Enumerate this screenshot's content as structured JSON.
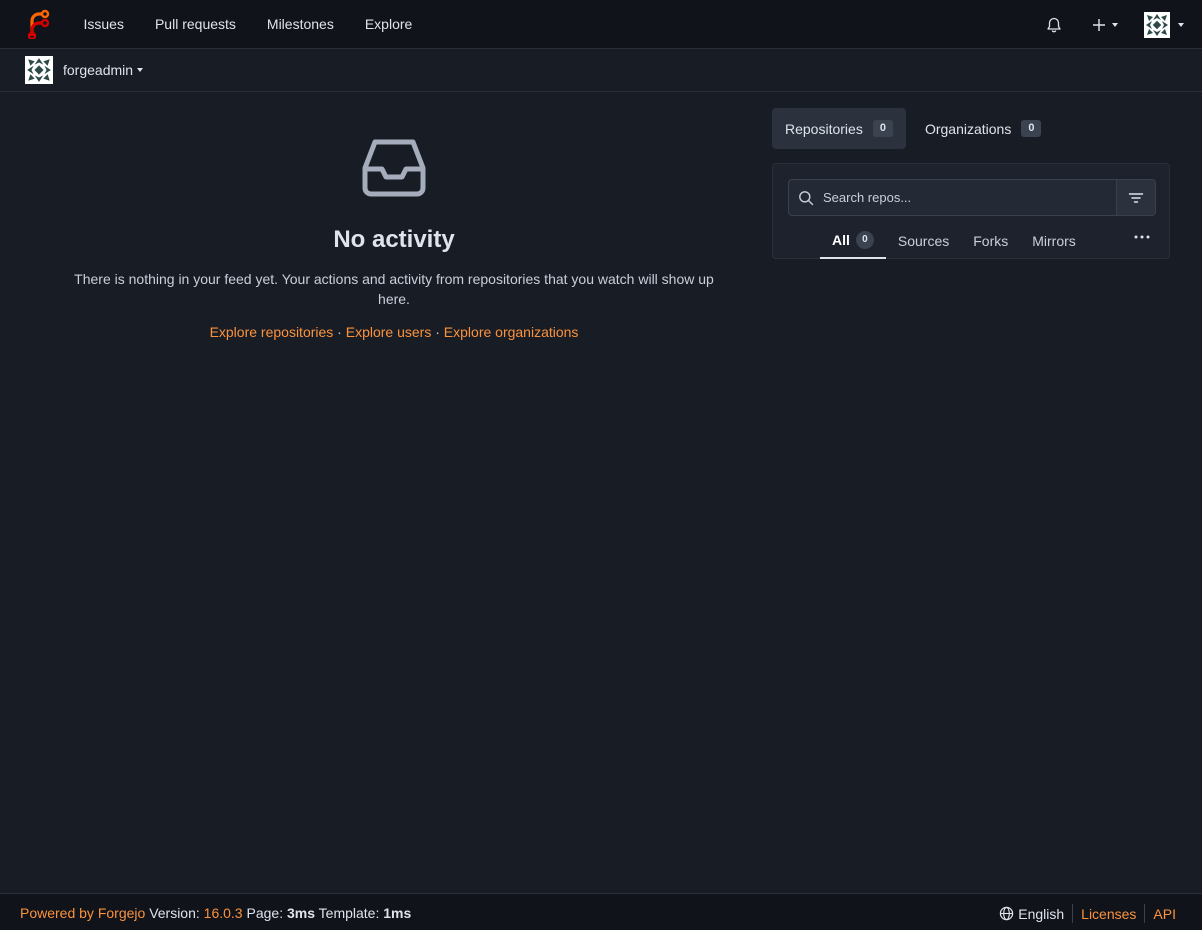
{
  "navbar": {
    "links": [
      "Issues",
      "Pull requests",
      "Milestones",
      "Explore"
    ],
    "brand_colors": {
      "orange": "#ff6600",
      "red": "#d40000"
    }
  },
  "context": {
    "username": "forgeadmin"
  },
  "feed": {
    "title": "No activity",
    "description": "There is nothing in your feed yet. Your actions and activity from repositories that you watch will show up here.",
    "links": [
      "Explore repositories",
      "Explore users",
      "Explore organizations"
    ],
    "separator": " · "
  },
  "sidebar": {
    "tabs": [
      {
        "label": "Repositories",
        "count": "0"
      },
      {
        "label": "Organizations",
        "count": "0"
      }
    ],
    "search": {
      "placeholder": "Search repos..."
    },
    "filters": [
      {
        "label": "All",
        "count": "0"
      },
      {
        "label": "Sources"
      },
      {
        "label": "Forks"
      },
      {
        "label": "Mirrors"
      }
    ]
  },
  "footer": {
    "powered_by": "Powered by Forgejo",
    "version_label": "Version:",
    "version": "16.0.3",
    "page_label": "Page:",
    "page_time": "3ms",
    "template_label": "Template:",
    "template_time": "1ms",
    "language": "English",
    "licenses": "Licenses",
    "api": "API"
  },
  "colors": {
    "accent": "#fb923c",
    "background": "#181c25",
    "navbar": "#10131a"
  }
}
